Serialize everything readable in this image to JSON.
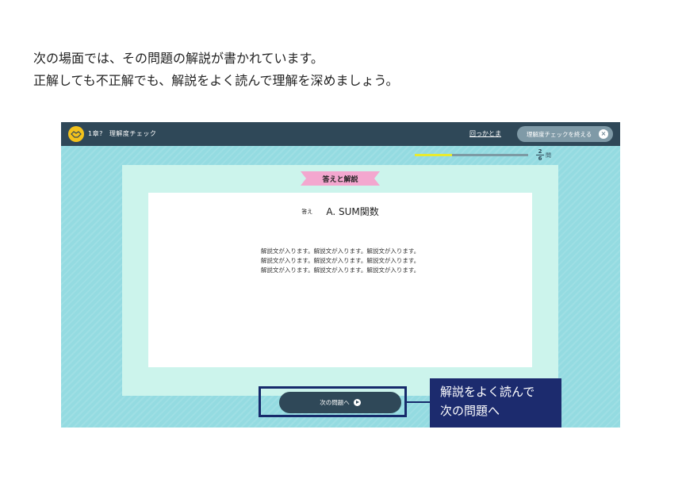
{
  "intro": {
    "line1": "次の場面では、その問題の解説が書かれています。",
    "line2": "正解しても不正解でも、解説をよく読んで理解を深めましょう。"
  },
  "header": {
    "chapter": "1章?",
    "title": "理解度チェック",
    "link": "回っかとま",
    "end_button": "理解度チェックを終える"
  },
  "progress": {
    "current": "2",
    "total": "6",
    "unit": "問",
    "fraction": 0.33
  },
  "panel": {
    "ribbon": "答えと解説",
    "answer_label": "答え",
    "answer_value": "A. SUM関数",
    "explanation": [
      "解説文が入ります。解説文が入ります。解説文が入ります。",
      "解説文が入ります。解説文が入ります。解説文が入ります。",
      "解説文が入ります。解説文が入ります。解説文が入ります。"
    ]
  },
  "next_button": "次の問題へ",
  "callout": {
    "line1": "解説をよく読んで",
    "line2": "次の問題へ"
  },
  "colors": {
    "header": "#2f4858",
    "background": "#94dbe1",
    "panel": "#ccf4ec",
    "ribbon": "#f3a7cf",
    "callout": "#1c2b6e",
    "progress_fill": "#e8ea2f"
  }
}
